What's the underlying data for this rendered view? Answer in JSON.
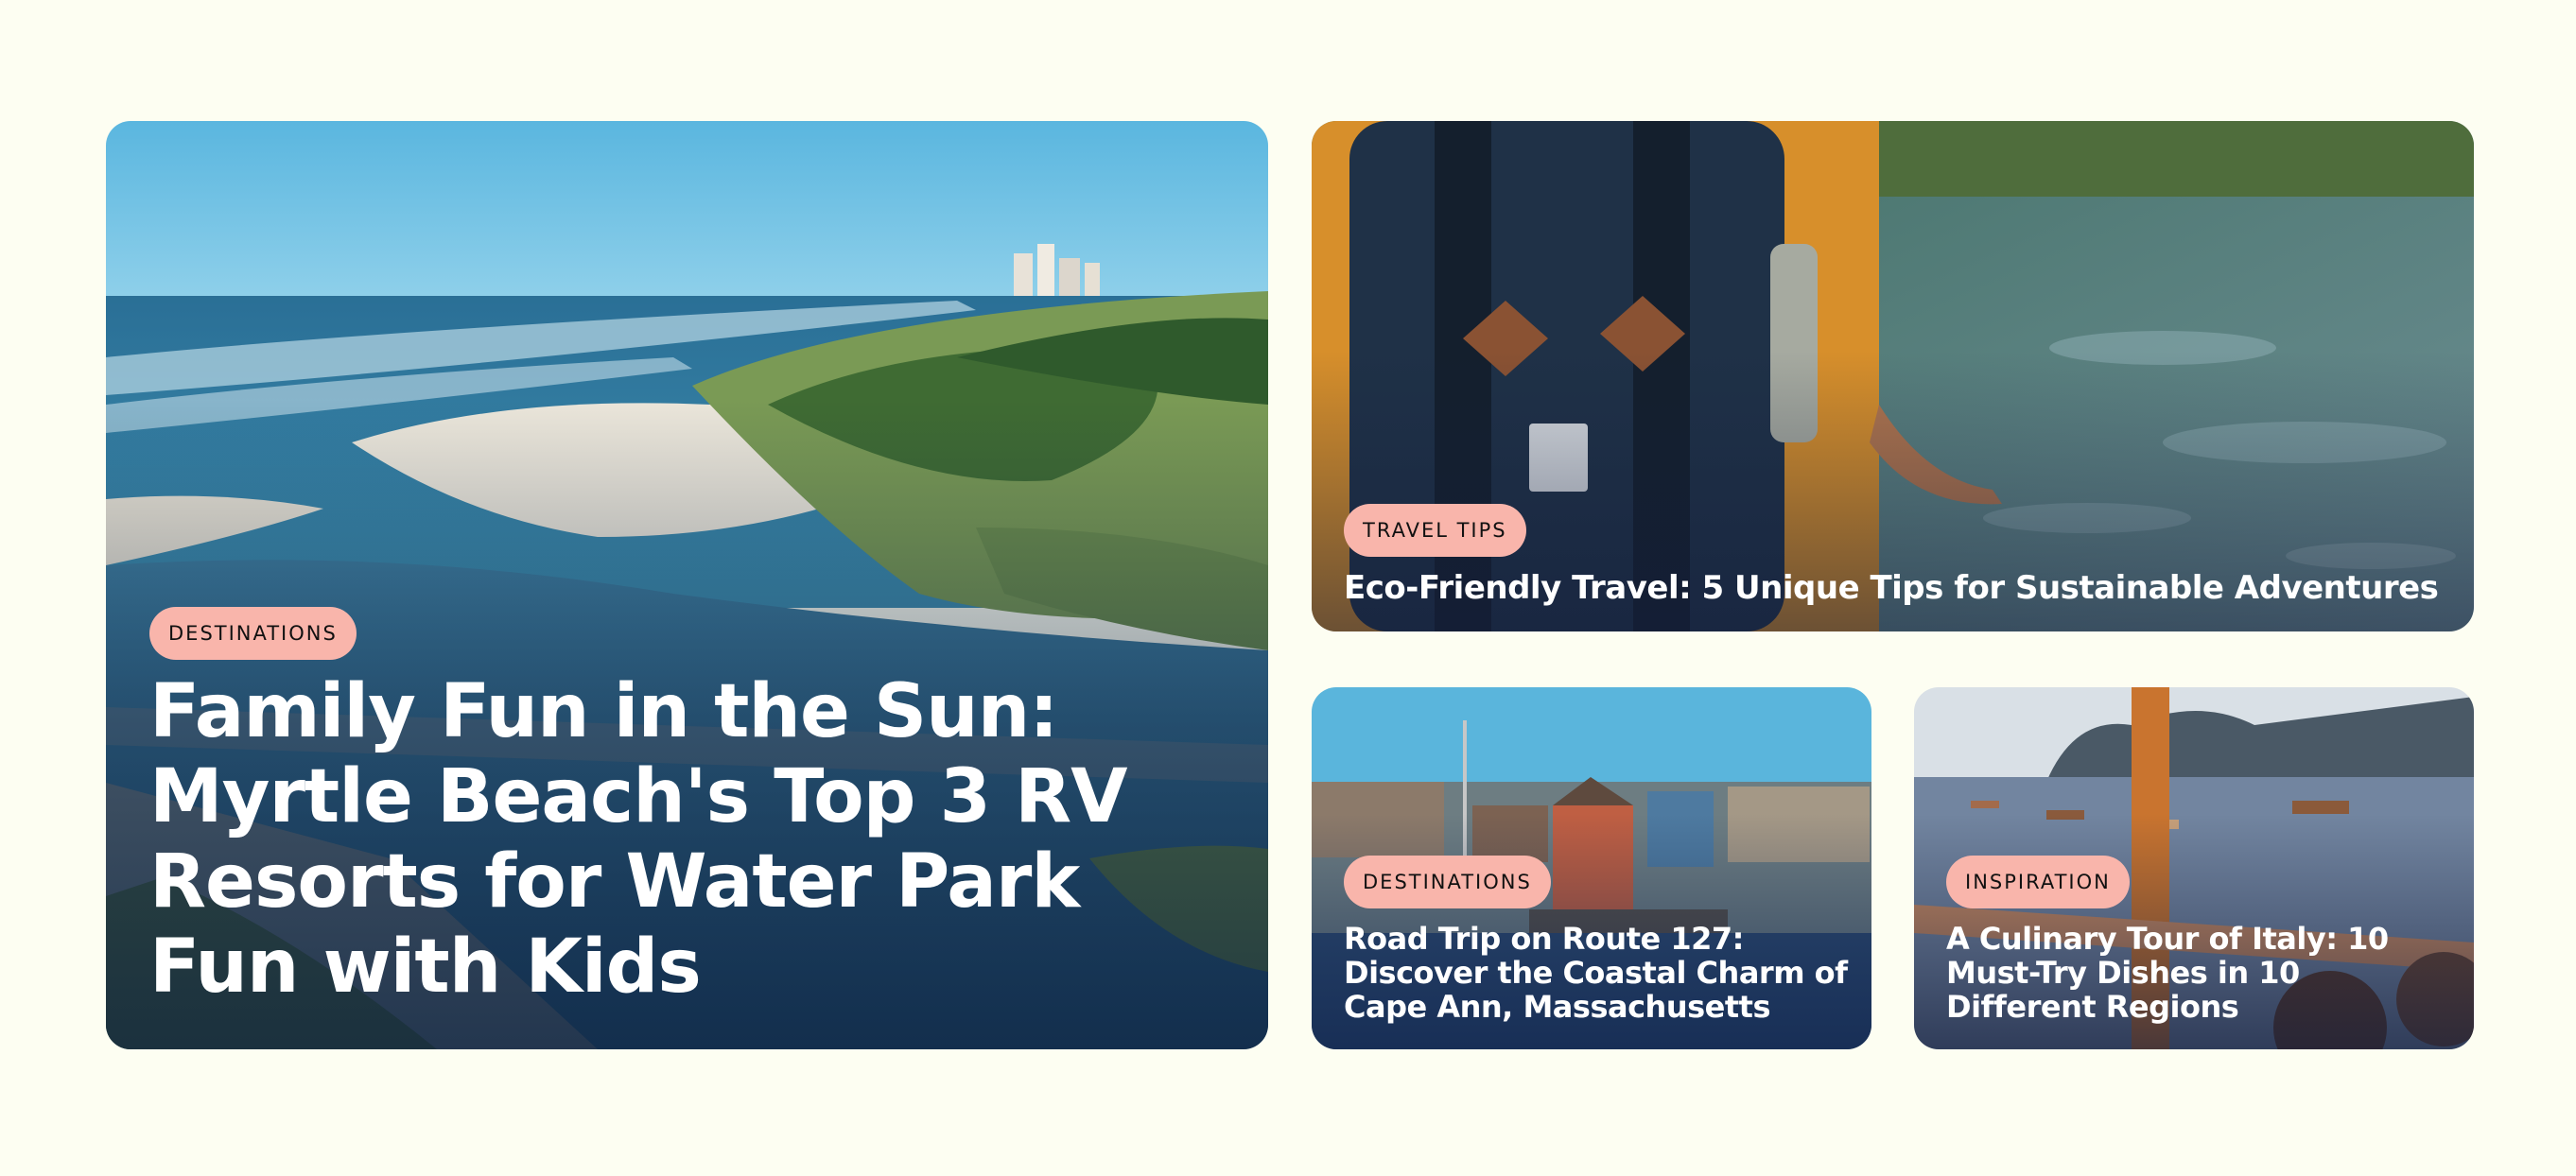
{
  "cards": [
    {
      "category": "DESTINATIONS",
      "title": "Family Fun in the Sun: Myrtle Beach's Top 3 RV Resorts for Water Park Fun with Kids"
    },
    {
      "category": "TRAVEL TIPS",
      "title": "Eco-Friendly Travel: 5 Unique Tips for Sustainable Adventures"
    },
    {
      "category": "DESTINATIONS",
      "title": "Road Trip on Route 127: Discover the Coastal Charm of Cape Ann, Massachusetts"
    },
    {
      "category": "INSPIRATION",
      "title": "A Culinary Tour of Italy: 10 Must-Try Dishes in 10 Different Regions"
    }
  ],
  "colors": {
    "page_background": "#fdfef2",
    "badge_background": "#f9b5ab",
    "badge_text": "#111111",
    "title_text": "#ffffff"
  }
}
